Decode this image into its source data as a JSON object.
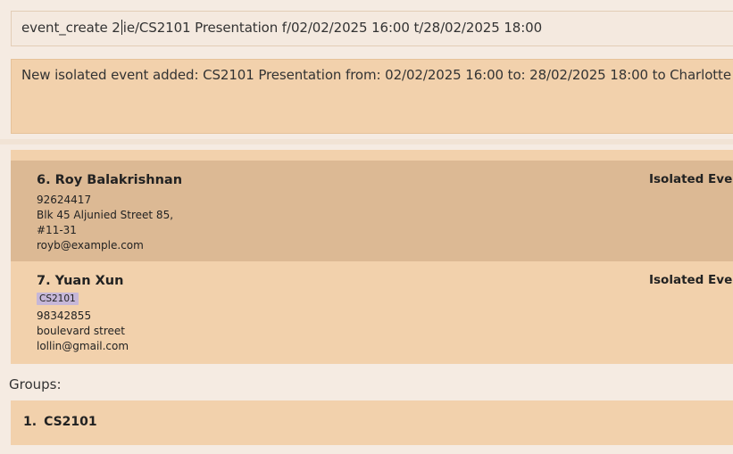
{
  "command_box": {
    "value_before_caret": "event_create 2",
    "value_after_caret": "ie/CS2101 Presentation f/02/02/2025 16:00 t/28/02/2025 18:00"
  },
  "result_display": {
    "message": "New isolated event added: CS2101 Presentation from: 02/02/2025 16:00 to: 28/02/2025 18:00 to Charlotte Olive"
  },
  "persons": [
    {
      "index_name": "6. Roy Balakrishnan",
      "tags": [],
      "phone": "92624417",
      "address_lines": [
        "Blk 45 Aljunied Street 85,",
        "#11-31"
      ],
      "email": "royb@example.com",
      "events_label": "Isolated Events"
    },
    {
      "index_name": "7. Yuan Xun",
      "tags": [
        "CS2101"
      ],
      "phone": "98342855",
      "address_lines": [
        "boulevard street"
      ],
      "email": "lollin@gmail.com",
      "events_label": "Isolated Events"
    }
  ],
  "groups": {
    "label": "Groups:",
    "items": [
      {
        "index": "1.",
        "name": "CS2101"
      }
    ]
  }
}
